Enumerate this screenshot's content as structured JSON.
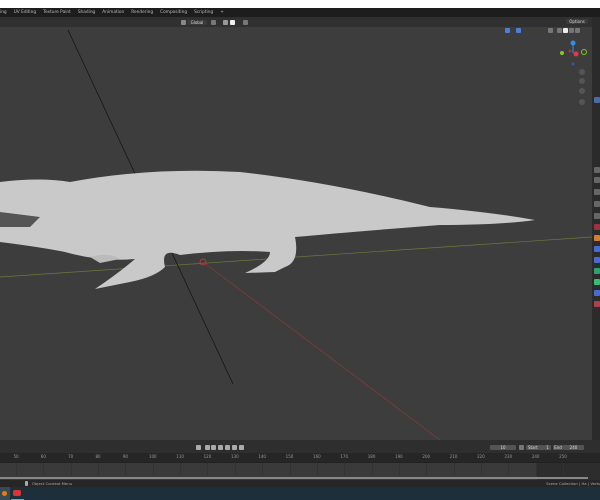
{
  "workspace_tabs": [
    "ing",
    "UV Editing",
    "Texture Paint",
    "Shading",
    "Animation",
    "Rendering",
    "Compositing",
    "Scripting",
    "+"
  ],
  "viewport_header": {
    "orientation": "Global",
    "options_label": "Options"
  },
  "gizmo": {
    "x": "X",
    "y": "Y",
    "z": "Z"
  },
  "timeline": {
    "current_frame": "10",
    "start_label": "Start",
    "start": "1",
    "end_label": "End",
    "end": "240",
    "ruler": [
      "50",
      "60",
      "70",
      "80",
      "90",
      "100",
      "110",
      "120",
      "130",
      "140",
      "150",
      "160",
      "170",
      "180",
      "190",
      "200",
      "210",
      "220",
      "230",
      "240",
      "250"
    ]
  },
  "status": {
    "left": "Object Context Menu",
    "right": "Scene Collection | Ha | Verts"
  },
  "colors": {
    "viewport": "#3d3d3d",
    "x_axis": "#e8344c",
    "y_axis": "#8bc820",
    "z_axis": "#2f8fe8"
  }
}
